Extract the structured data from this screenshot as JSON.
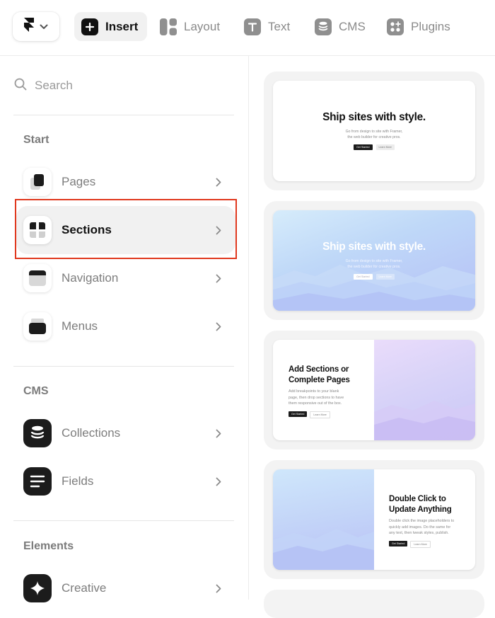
{
  "toolbar": {
    "tools": [
      {
        "label": "Insert",
        "icon": "plus-icon",
        "active": true
      },
      {
        "label": "Layout",
        "icon": "layout-icon"
      },
      {
        "label": "Text",
        "icon": "text-icon"
      },
      {
        "label": "CMS",
        "icon": "database-icon"
      },
      {
        "label": "Plugins",
        "icon": "plugins-icon"
      }
    ]
  },
  "search": {
    "placeholder": "Search"
  },
  "groups": {
    "start": {
      "title": "Start",
      "items": [
        {
          "label": "Pages",
          "icon": "pages-icon"
        },
        {
          "label": "Sections",
          "icon": "sections-icon",
          "selected": true
        },
        {
          "label": "Navigation",
          "icon": "navigation-icon"
        },
        {
          "label": "Menus",
          "icon": "menus-icon"
        }
      ]
    },
    "cms": {
      "title": "CMS",
      "items": [
        {
          "label": "Collections",
          "icon": "collections-icon"
        },
        {
          "label": "Fields",
          "icon": "fields-icon"
        }
      ]
    },
    "elements": {
      "title": "Elements",
      "items": [
        {
          "label": "Creative",
          "icon": "sparkle-icon"
        }
      ]
    }
  },
  "previews": [
    {
      "title": "Ship sites with style.",
      "subtitle_line1": "Go from design to site with Framer,",
      "subtitle_line2": "the web builder for creative pros.",
      "primary": "Get Started",
      "secondary": "Learn More"
    },
    {
      "title": "Ship sites with style.",
      "subtitle_line1": "Go from design to site with Framer,",
      "subtitle_line2": "the web builder for creative pros.",
      "primary": "Get Started",
      "secondary": "Learn More"
    },
    {
      "title_line1": "Add Sections or",
      "title_line2": "Complete Pages",
      "subtitle_line1": "Add breakpoints to your blank",
      "subtitle_line2": "page, then drop sections to have",
      "subtitle_line3": "them responsive out of the box.",
      "primary": "Get Started",
      "secondary": "Learn More"
    },
    {
      "title_line1": "Double Click to",
      "title_line2": "Update Anything",
      "subtitle_line1": "Double click the image placeholders to",
      "subtitle_line2": "quickly add images. Do the same for",
      "subtitle_line3": "any text, then tweak styles, publish.",
      "primary": "Get Started",
      "secondary": "Learn More"
    }
  ],
  "colors": {
    "highlight": "#e0381e",
    "selected_bg": "#f1f1f1",
    "active_tool_bg": "#f1f1f1"
  }
}
